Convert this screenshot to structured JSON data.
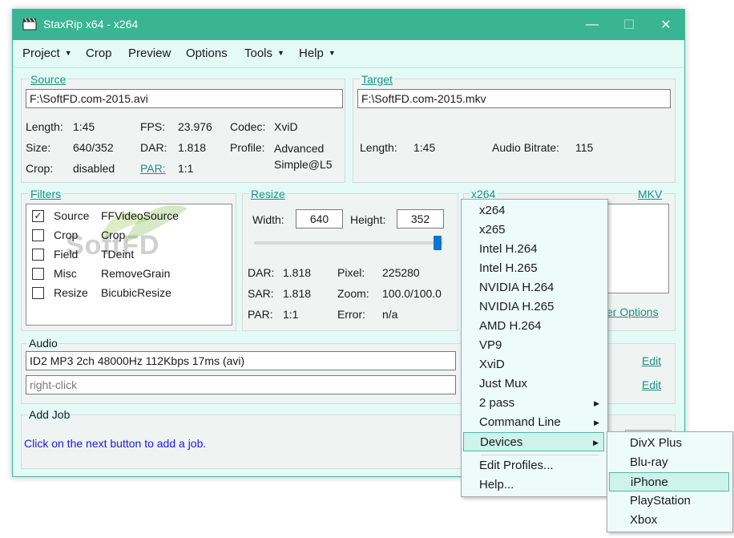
{
  "window": {
    "title": "StaxRip x64 - x264",
    "controls": {
      "minimize": "—",
      "maximize": "☐",
      "close": "✕"
    }
  },
  "menubar": [
    {
      "label": "Project",
      "caret": "▼"
    },
    {
      "label": "Crop",
      "caret": ""
    },
    {
      "label": "Preview",
      "caret": ""
    },
    {
      "label": "Options",
      "caret": ""
    },
    {
      "label": "Tools",
      "caret": "▼"
    },
    {
      "label": "Help",
      "caret": "▼"
    }
  ],
  "source": {
    "title": "Source",
    "file": "F:\\SoftFD.com-2015.avi",
    "length_label": "Length:",
    "length": "1:45",
    "size_label": "Size:",
    "size": "640/352",
    "crop_label": "Crop:",
    "crop": "disabled",
    "fps_label": "FPS:",
    "fps": "23.976",
    "dar_label": "DAR:",
    "dar": "1.818",
    "par_label": "PAR:",
    "par": "1:1",
    "codec_label": "Codec:",
    "codec": "XviD",
    "profile_label": "Profile:",
    "profile_line1": "Advanced",
    "profile_line2": "Simple@L5"
  },
  "target": {
    "title": "Target",
    "file": "F:\\SoftFD.com-2015.mkv",
    "length_label": "Length:",
    "length": "1:45",
    "audio_bitrate_label": "Audio Bitrate:",
    "audio_bitrate": "115"
  },
  "filters": {
    "title": "Filters",
    "items": [
      {
        "checked": true,
        "check_mark": "✓",
        "name": "Source",
        "value": "FFVideoSource"
      },
      {
        "checked": false,
        "check_mark": "",
        "name": "Crop",
        "value": "Crop"
      },
      {
        "checked": false,
        "check_mark": "",
        "name": "Field",
        "value": "TDeint"
      },
      {
        "checked": false,
        "check_mark": "",
        "name": "Misc",
        "value": "RemoveGrain"
      },
      {
        "checked": false,
        "check_mark": "",
        "name": "Resize",
        "value": "BicubicResize"
      }
    ]
  },
  "watermark": {
    "text": "SoftFD"
  },
  "resize": {
    "title": "Resize",
    "width_label": "Width:",
    "width": "640",
    "height_label": "Height:",
    "height": "352",
    "slider_level": 0.99,
    "dar_label": "DAR:",
    "dar": "1.818",
    "sar_label": "SAR:",
    "sar": "1.818",
    "par_label": "PAR:",
    "par": "1:1",
    "pixel_label": "Pixel:",
    "pixel": "225280",
    "zoom_label": "Zoom:",
    "zoom": "100.0/100.0",
    "error_label": "Error:",
    "error": "n/a"
  },
  "encoder": {
    "title": "x264",
    "container": "MKV",
    "more_options_partial": "er Options"
  },
  "audio": {
    "title": "Audio",
    "track1": "ID2 MP3 2ch 48000Hz 112Kbps 17ms (avi)",
    "track2_placeholder": "right-click",
    "edit1": "Edit",
    "edit2": "Edit"
  },
  "add_job": {
    "title": "Add Job",
    "hint": "Click on the next button to add a job."
  },
  "encoder_menu": {
    "items": [
      "x264",
      "x265",
      "Intel H.264",
      "Intel H.265",
      "NVIDIA H.264",
      "NVIDIA H.265",
      "AMD H.264",
      "VP9",
      "XviD",
      "Just Mux"
    ],
    "two_pass": "2 pass",
    "command_line": "Command Line",
    "devices": "Devices",
    "edit_profiles": "Edit Profiles...",
    "help": "Help...",
    "submenu_arrow": "▶"
  },
  "devices_menu": {
    "items": [
      "DivX Plus",
      "Blu-ray",
      "iPhone",
      "PlayStation",
      "Xbox"
    ],
    "highlighted": "iPhone"
  },
  "colors": {
    "accent": "#39b593",
    "link": "#1f8f82",
    "window_bg": "#e3faf5",
    "hint": "#1a1adb"
  }
}
